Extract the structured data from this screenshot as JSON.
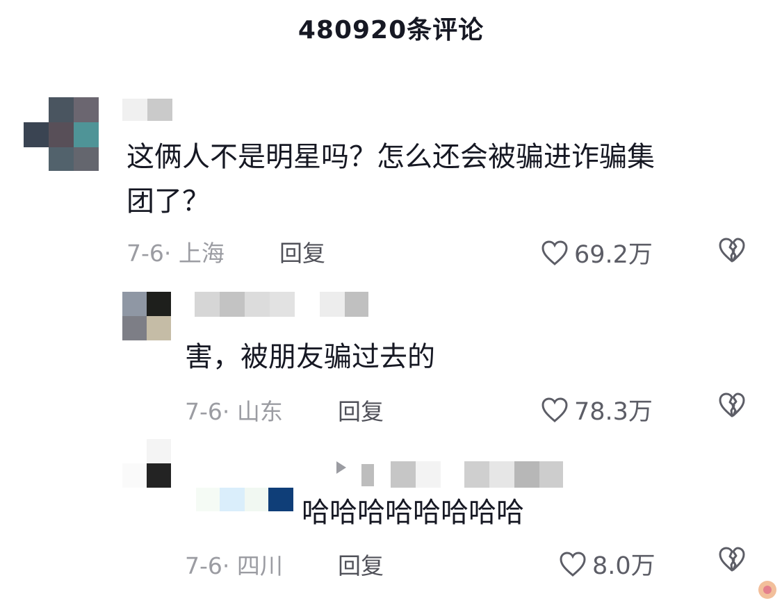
{
  "header": {
    "title": "480920条评论"
  },
  "comments": [
    {
      "text_line1": "这俩人不是明星吗？怎么还会被骗进诈骗集",
      "text_line2": "团了？",
      "date": "7-6",
      "location": "上海",
      "reply_label": "回复",
      "likes": "69.2万"
    },
    {
      "text_line1": "害，被朋友骗过去的",
      "date": "7-6",
      "location": "山东",
      "reply_label": "回复",
      "likes": "78.3万"
    },
    {
      "text_line1": "哈哈哈哈哈哈哈哈",
      "date": "7-6",
      "location": "四川",
      "reply_label": "回复",
      "likes": "8.0万"
    }
  ],
  "icons": {
    "like": "heart-outline-icon",
    "dislike": "broken-heart-icon",
    "reply_arrow": "play-arrow-icon"
  },
  "colors": {
    "text": "#161823",
    "meta": "#9b9ca2",
    "action": "#505159"
  }
}
